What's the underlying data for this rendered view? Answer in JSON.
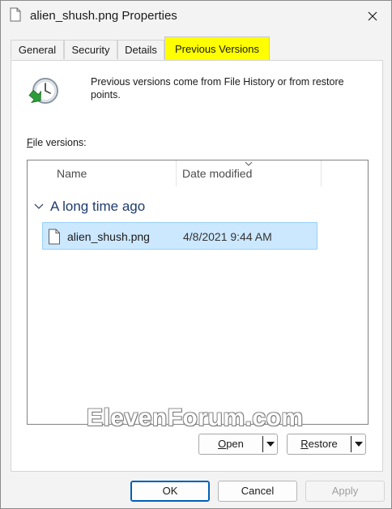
{
  "window": {
    "title": "alien_shush.png Properties"
  },
  "tabs": [
    {
      "label": "General"
    },
    {
      "label": "Security"
    },
    {
      "label": "Details"
    },
    {
      "label": "Previous Versions",
      "active": true
    }
  ],
  "info": {
    "text": "Previous versions come from File History or from restore points."
  },
  "file_versions": {
    "label_accel": "F",
    "label_rest": "ile versions:",
    "columns": [
      "Name",
      "Date modified"
    ],
    "groups": [
      {
        "title": "A long time ago",
        "items": [
          {
            "name": "alien_shush.png",
            "date": "4/8/2021 9:44 AM",
            "selected": true
          }
        ]
      }
    ]
  },
  "actions": {
    "open_accel": "O",
    "open_rest": "pen",
    "restore_accel": "R",
    "restore_rest": "estore"
  },
  "watermark": "ElevenForum.com",
  "footer": {
    "ok": "OK",
    "cancel": "Cancel",
    "apply": "Apply"
  },
  "colors": {
    "active_tab": "#ffff00",
    "selection": "#cce8ff",
    "group_title": "#1e3a6e",
    "ok_border": "#005fb8"
  },
  "icons": {
    "title": "document-icon",
    "info": "history-clock-icon",
    "file": "document-icon"
  }
}
